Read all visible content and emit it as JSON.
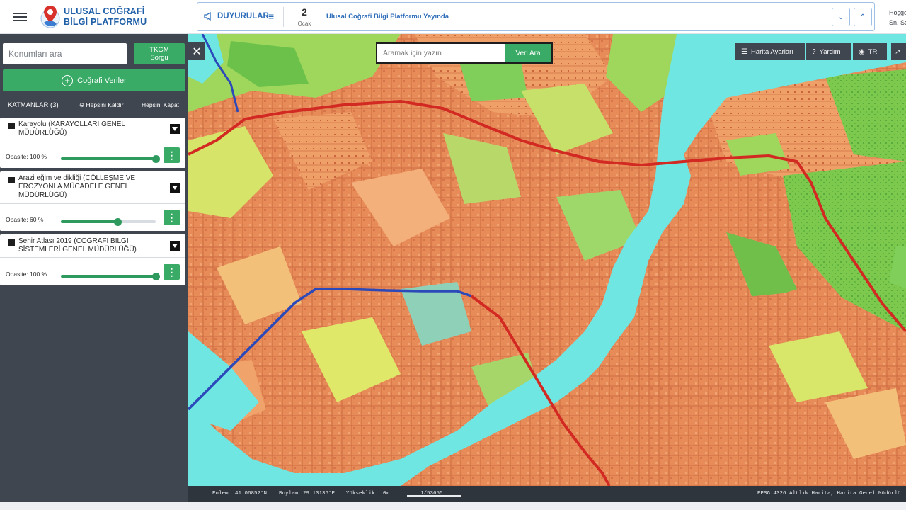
{
  "header": {
    "brand_line1": "ULUSAL COĞRAFİ",
    "brand_line2": "BİLGİ PLATFORMU",
    "announcements_label": "DUYURULAR",
    "announcement_day": "2",
    "announcement_month": "Ocak",
    "announcement_text": "Ulusal Coğrafi Bilgi Platformu Yayında",
    "greeting_line1": "Hoşge",
    "greeting_line2": "Sn. Sa"
  },
  "sidebar": {
    "location_placeholder": "Konumları ara",
    "tkgm_line1": "TKGM",
    "tkgm_line2": "Sorgu",
    "geo_button": "Coğrafi Veriler",
    "layers_title": "KATMANLAR (3)",
    "hide_all": "Hepsini Kaldır",
    "close_all": "Hepsini Kapat",
    "layers": [
      {
        "name": "Karayolu (KARAYOLLARI GENEL MÜDÜRLÜĞÜ)",
        "opacity_label": "Opasite: 100 %",
        "opacity": 100
      },
      {
        "name": "Arazi eğim ve dikliği (ÇÖLLEŞME VE EROZYONLA MÜCADELE GENEL MÜDÜRLÜĞÜ)",
        "opacity_label": "Opasite: 60 %",
        "opacity": 60
      },
      {
        "name": "Şehir Atlası 2019 (COĞRAFİ BİLGİ SİSTEMLERİ GENEL MÜDÜRLÜĞÜ)",
        "opacity_label": "Opasite: 100 %",
        "opacity": 100
      }
    ]
  },
  "map": {
    "search_placeholder": "Aramak için yazın",
    "search_button": "Veri Ara",
    "map_settings": "Harita Ayarları",
    "help": "Yardım",
    "language": "TR"
  },
  "status": {
    "lat_label": "Enlem",
    "lat_value": "41.06852°N",
    "lon_label": "Boylam",
    "lon_value": "29.13136°E",
    "elevation_label": "Yükseklik",
    "elevation_value": "0m",
    "scale": "1/53655",
    "attribution": "EPSG:4326 Altlık Harita, Harita Genel Müdürlü"
  },
  "colors": {
    "accent_green": "#3aaa67",
    "sidebar_bg": "#3f4650",
    "brand_blue": "#1f5fa8",
    "water": "#6fe6e2",
    "road_red": "#d22a22",
    "road_blue": "#2b49b8"
  }
}
